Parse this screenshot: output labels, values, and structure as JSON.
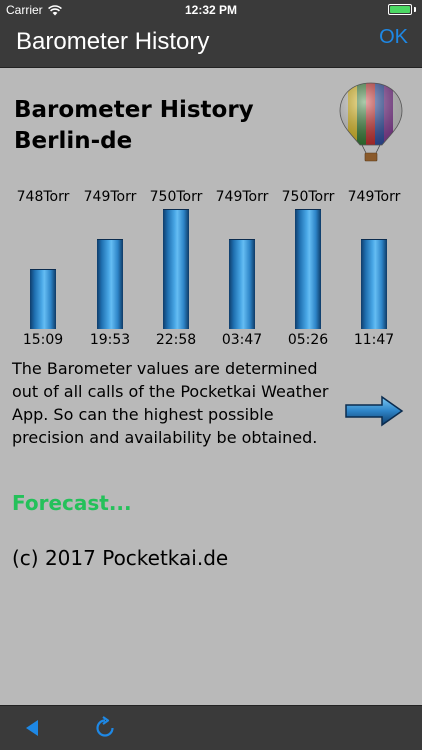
{
  "status_bar": {
    "carrier": "Carrier",
    "time": "12:32 PM",
    "icons": [
      "wifi-icon",
      "battery-icon"
    ]
  },
  "nav": {
    "title": "Barometer History",
    "ok_label": "OK"
  },
  "header": {
    "line1": "Barometer History",
    "line2": "Berlin-de"
  },
  "colors": {
    "bar_blue": "#2d84c7",
    "forecast_green": "#24c15a",
    "link_blue": "#1e88e5",
    "bar_background": "#3a3a3a",
    "page_background": "#b9b9b9"
  },
  "chart_data": {
    "type": "bar",
    "categories": [
      "15:09",
      "19:53",
      "22:58",
      "03:47",
      "05:26",
      "11:47"
    ],
    "values": [
      748,
      749,
      750,
      749,
      750,
      749
    ],
    "value_labels": [
      "748Torr",
      "749Torr",
      "750Torr",
      "749Torr",
      "750Torr",
      "749Torr"
    ]
  },
  "description": "The Barometer values are determined out of all calls of the Pocketkai Weather App. So can the highest possible precision and availability be obtained.",
  "forecast_link": "Forecast...",
  "copyright": "(c) 2017 Pocketkai.de",
  "toolbar": {
    "icons": [
      "back-icon",
      "refresh-icon"
    ]
  }
}
